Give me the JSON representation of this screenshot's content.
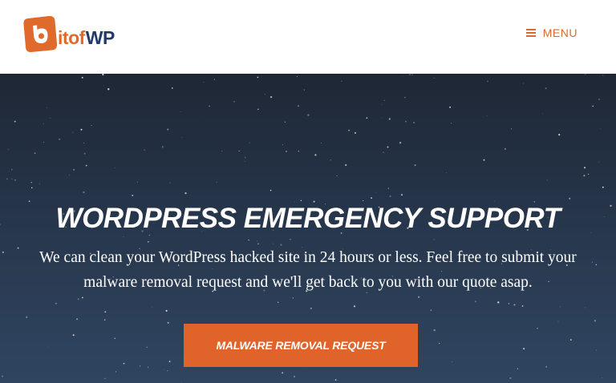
{
  "header": {
    "logo": {
      "mark_letter": "b",
      "text_part1": "it",
      "text_part2": "of",
      "text_part3": "WP"
    },
    "menu": {
      "icon": "hamburger-icon",
      "label": "MENU"
    }
  },
  "hero": {
    "title": "WordPress Emergency Support",
    "description": "We can clean your WordPress hacked site in 24 hours or less. Feel free to submit your malware removal request and we'll get back to you with our quote asap.",
    "cta_label": "Malware Removal Request"
  },
  "colors": {
    "brand_orange": "#e0632a",
    "brand_navy": "#213a6b",
    "hero_background": "#26344a",
    "text_light": "#ffffff"
  }
}
